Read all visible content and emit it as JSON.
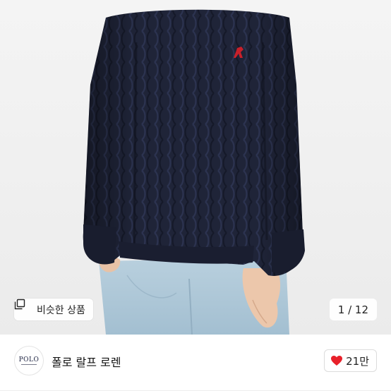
{
  "product": {
    "similar_button_label": "비슷한 상품",
    "page_counter": "1 / 12",
    "current_image": 1,
    "total_images": 12
  },
  "shop": {
    "logo_text": "POLO",
    "name": "폴로 랄프 로렌"
  },
  "like": {
    "count": "21만"
  },
  "icons": {
    "similar": "similar-items-icon",
    "like": "heart-icon"
  },
  "colors": {
    "heart": "#e8202a",
    "sweater": "#1d2236",
    "jeans": "#a8c4d6",
    "background": "#f2f2f2"
  }
}
